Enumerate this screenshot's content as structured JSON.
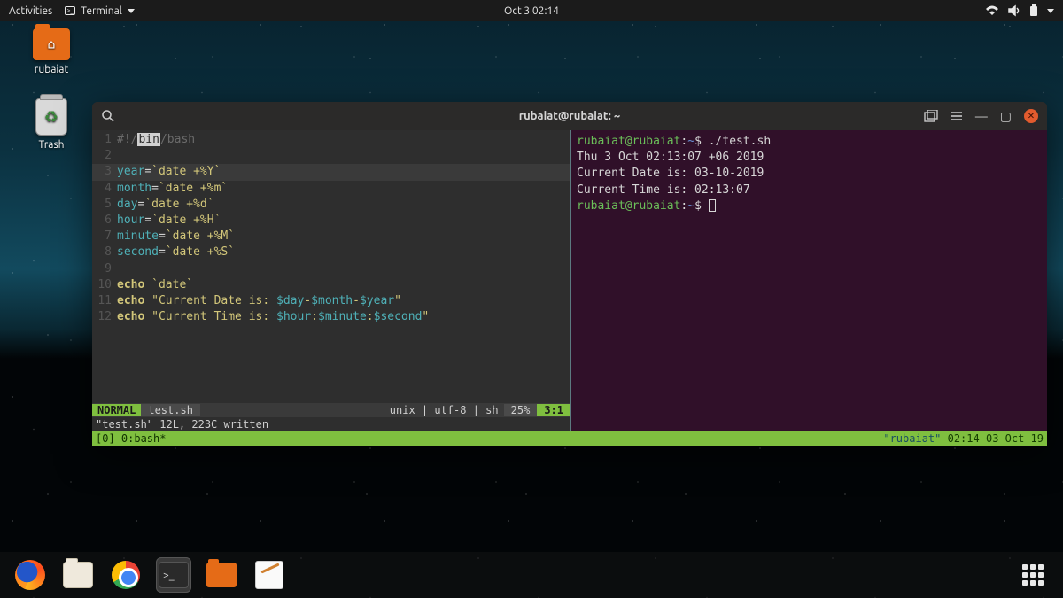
{
  "topbar": {
    "activities": "Activities",
    "app_name": "Terminal",
    "datetime": "Oct 3  02:14"
  },
  "desktop": {
    "home_label": "rubaiat",
    "trash_label": "Trash"
  },
  "window": {
    "title": "rubaiat@rubaiat: ~"
  },
  "editor": {
    "lines": [
      {
        "n": "1",
        "kind": "shebang"
      },
      {
        "n": "2",
        "kind": "blank"
      },
      {
        "n": "3",
        "kind": "assign",
        "var": "year",
        "cmd": "date +%Y",
        "cursor": true
      },
      {
        "n": "4",
        "kind": "assign",
        "var": "month",
        "cmd": "date +%m"
      },
      {
        "n": "5",
        "kind": "assign",
        "var": "day",
        "cmd": "date +%d"
      },
      {
        "n": "6",
        "kind": "assign",
        "var": "hour",
        "cmd": "date +%H"
      },
      {
        "n": "7",
        "kind": "assign",
        "var": "minute",
        "cmd": "date +%M"
      },
      {
        "n": "8",
        "kind": "assign",
        "var": "second",
        "cmd": "date +%S"
      },
      {
        "n": "9",
        "kind": "blank"
      },
      {
        "n": "10",
        "kind": "echo_date"
      },
      {
        "n": "11",
        "kind": "echo_str",
        "text": "\"Current Date is: $day-$month-$year\""
      },
      {
        "n": "12",
        "kind": "echo_str",
        "text": "\"Current Time is: $hour:$minute:$second\""
      }
    ],
    "shebang_pre": "#!/",
    "shebang_hi": "bin",
    "shebang_post": "/bash",
    "echo_kw": "echo",
    "date_kw": "date"
  },
  "vim": {
    "mode": " NORMAL ",
    "file": "test.sh",
    "encoding": "unix | utf-8 | sh",
    "percent": "25%",
    "position": "3:1",
    "message": "\"test.sh\" 12L, 223C written"
  },
  "tmux": {
    "left": "[0] 0:bash*",
    "host": "\"rubaiat\"",
    "time": "02:14",
    "date": "03-Oct-19"
  },
  "shell": {
    "prompt_user": "rubaiat@rubaiat",
    "prompt_sep": ":",
    "prompt_path": "~",
    "prompt_sym": "$",
    "cmd": "./test.sh",
    "out1": "Thu 3 Oct 02:13:07 +06 2019",
    "out2": "Current Date is: 03-10-2019",
    "out3": "Current Time is: 02:13:07"
  }
}
